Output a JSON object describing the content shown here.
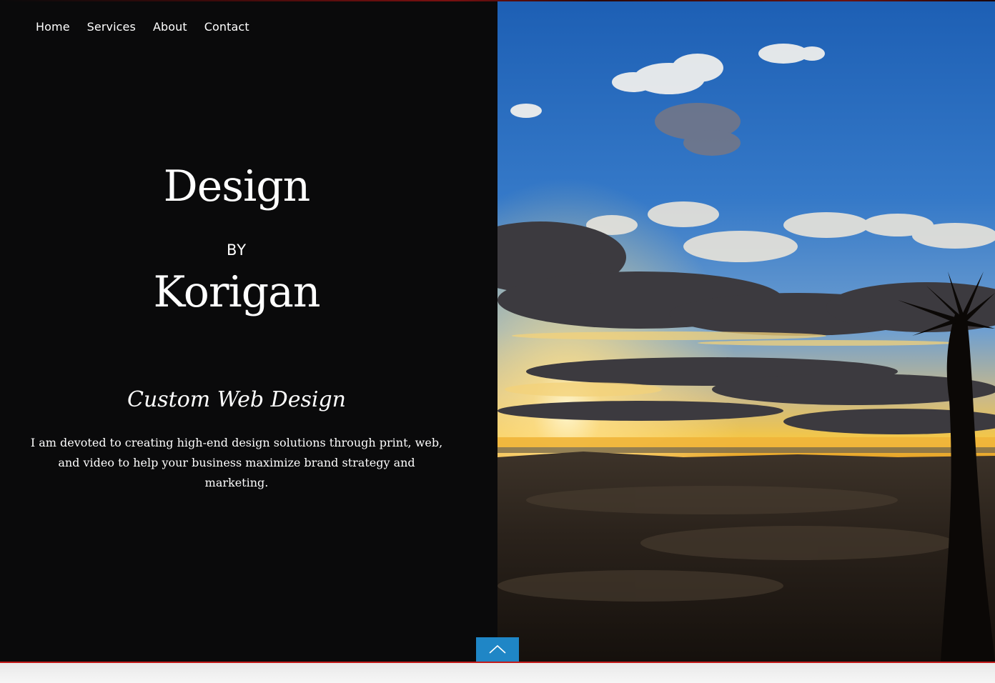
{
  "nav": {
    "items": [
      {
        "label": "Home"
      },
      {
        "label": "Services"
      },
      {
        "label": "About"
      },
      {
        "label": "Contact"
      }
    ]
  },
  "hero": {
    "title_line1": "Design",
    "title_line2": "BY",
    "title_line3": "Korigan",
    "subtitle": "Custom Web Design",
    "description": "I am devoted to creating high-end design solutions through print, web, and video to help your business maximize brand strategy and marketing."
  },
  "scroll_top": {
    "icon": "chevron-up-icon"
  },
  "colors": {
    "left_background": "#0a0a0b",
    "text": "#ffffff",
    "scroll_button": "#1f86c6",
    "accent_line": "#c21a1a"
  }
}
